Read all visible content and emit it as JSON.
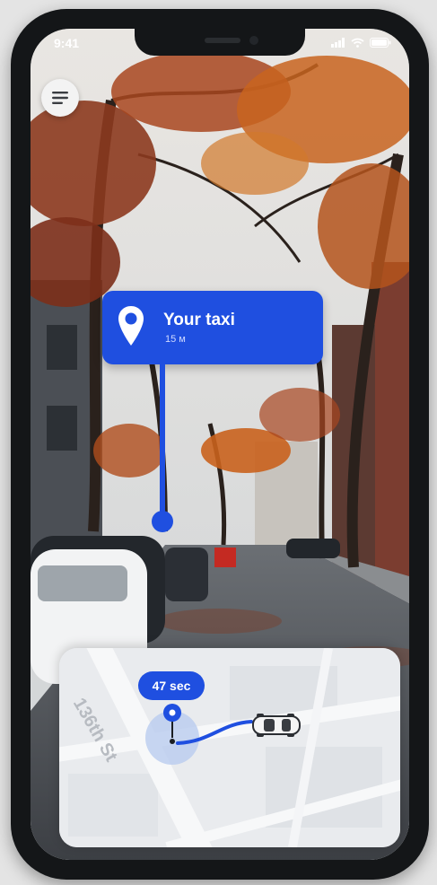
{
  "status_bar": {
    "time": "9:41",
    "icons": [
      "signal-icon",
      "wifi-icon",
      "battery-icon"
    ]
  },
  "menu_button": {
    "icon": "hamburger-menu-icon"
  },
  "taxi_card": {
    "title": "Your taxi",
    "distance": "15 м",
    "icon": "location-pin-icon"
  },
  "map": {
    "street_label": "136th St",
    "eta": "47 sec",
    "car_icon": "car-icon"
  },
  "colors": {
    "accent": "#1f4fe0",
    "map_bg": "#e9ebee"
  }
}
